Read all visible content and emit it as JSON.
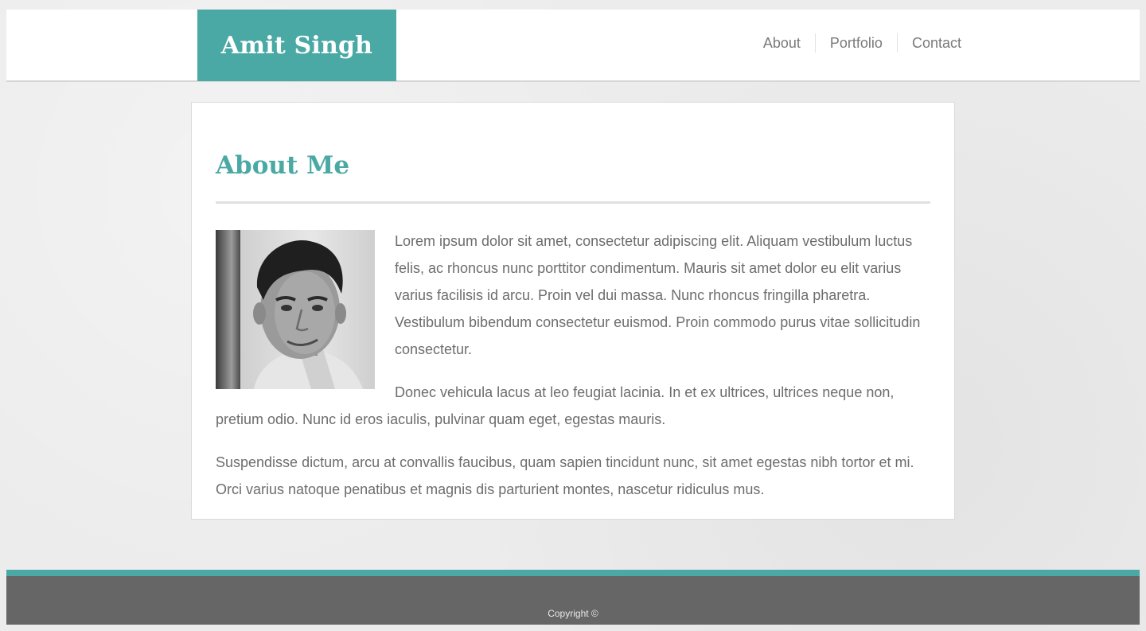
{
  "header": {
    "brand": "Amit Singh",
    "nav": [
      {
        "label": "About"
      },
      {
        "label": "Portfolio"
      },
      {
        "label": "Contact"
      }
    ]
  },
  "about": {
    "title": "About Me",
    "photo_icon": "profile-photo",
    "paragraphs": [
      "Lorem ipsum dolor sit amet, consectetur adipiscing elit. Aliquam vestibulum luctus felis, ac rhoncus nunc porttitor condimentum. Mauris sit amet dolor eu elit varius varius facilisis id arcu. Proin vel dui massa. Nunc rhoncus fringilla pharetra. Vestibulum bibendum consectetur euismod. Proin commodo purus vitae sollicitudin consectetur.",
      "Donec vehicula lacus at leo feugiat lacinia. In et ex ultrices, ultrices neque non, pretium odio. Nunc id eros iaculis, pulvinar quam eget, egestas mauris.",
      "Suspendisse dictum, arcu at convallis faucibus, quam sapien tincidunt nunc, sit amet egestas nibh tortor et mi. Orci varius natoque penatibus et magnis dis parturient montes, nascetur ridiculus mus."
    ]
  },
  "footer": {
    "copyright": "Copyright ©"
  },
  "colors": {
    "accent": "#4aa9a4",
    "footer_bg": "#666666",
    "text": "#6d6d6d"
  }
}
